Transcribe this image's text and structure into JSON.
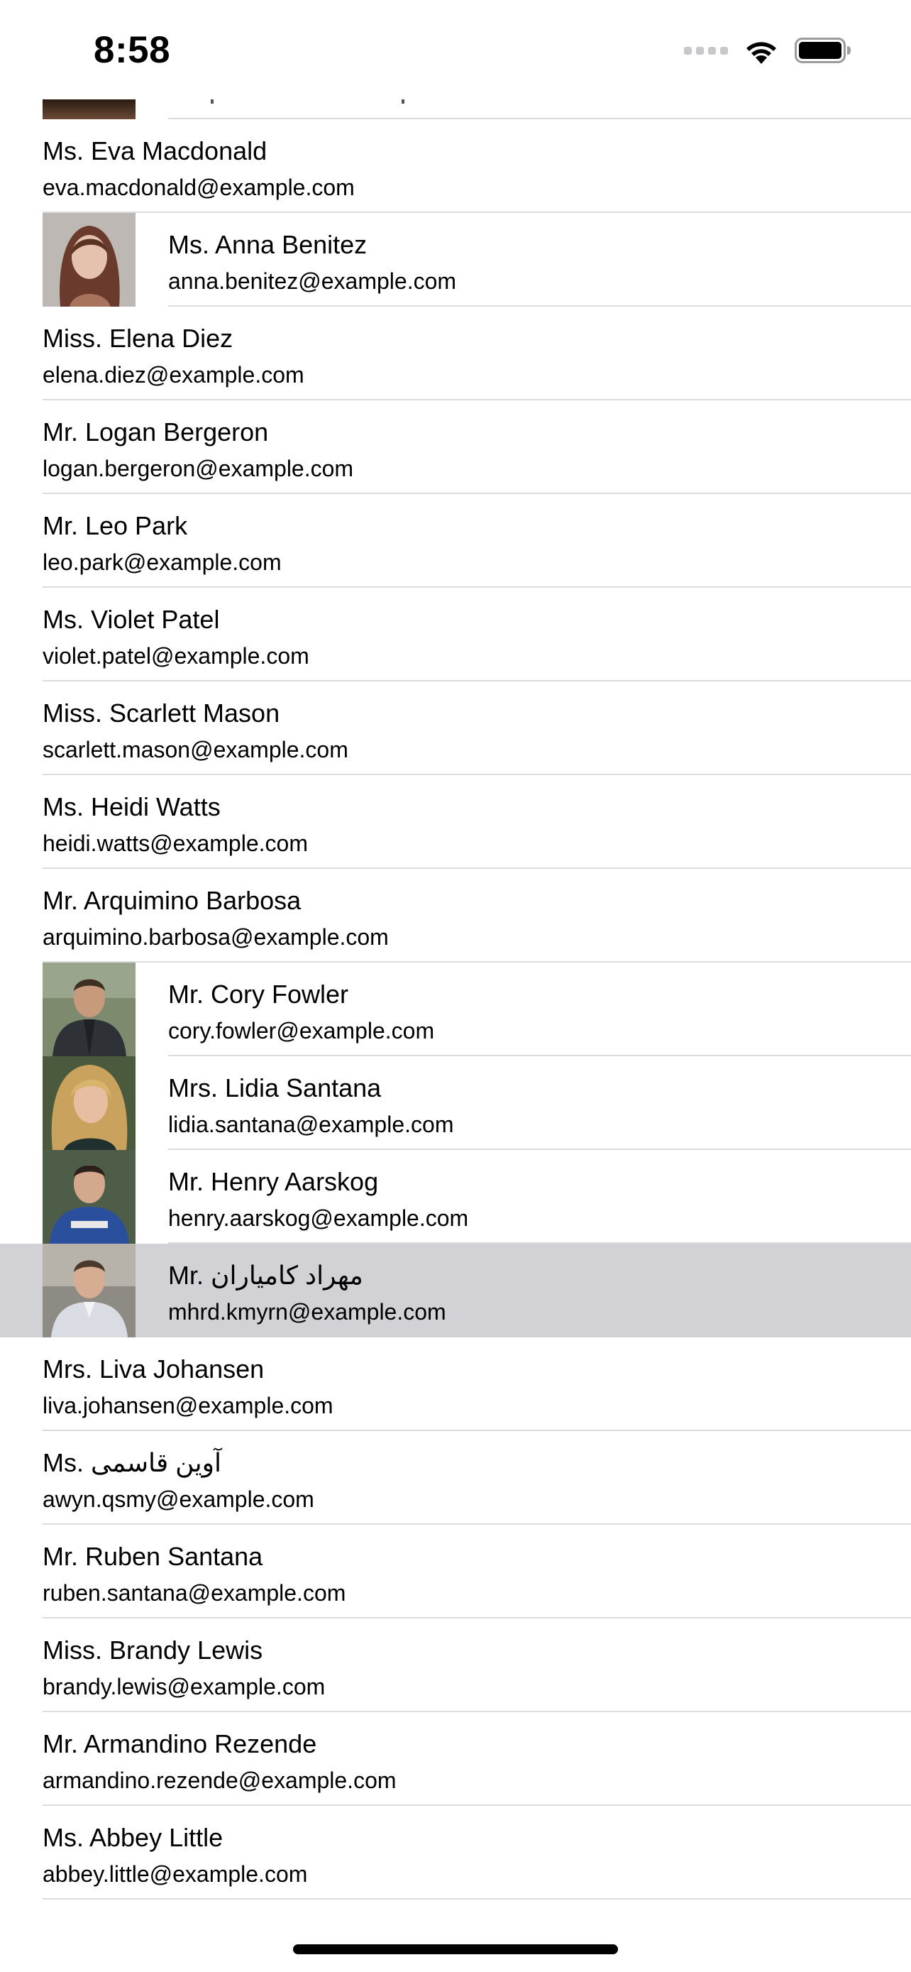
{
  "status_bar": {
    "time": "8:58"
  },
  "contacts": [
    {
      "name": "Ms. Eva Macdonald",
      "email": "eva.macdonald@example.com"
    },
    {
      "name": "Ms. Anna Benitez",
      "email": "anna.benitez@example.com"
    },
    {
      "name": "Miss. Elena Diez",
      "email": "elena.diez@example.com"
    },
    {
      "name": "Mr. Logan Bergeron",
      "email": "logan.bergeron@example.com"
    },
    {
      "name": "Mr. Leo Park",
      "email": "leo.park@example.com"
    },
    {
      "name": "Ms. Violet Patel",
      "email": "violet.patel@example.com"
    },
    {
      "name": "Miss. Scarlett Mason",
      "email": "scarlett.mason@example.com"
    },
    {
      "name": "Ms. Heidi Watts",
      "email": "heidi.watts@example.com"
    },
    {
      "name": "Mr. Arquimino Barbosa",
      "email": "arquimino.barbosa@example.com"
    },
    {
      "name": "Mr. Cory Fowler",
      "email": "cory.fowler@example.com"
    },
    {
      "name": "Mrs. Lidia Santana",
      "email": "lidia.santana@example.com"
    },
    {
      "name": "Mr. Henry Aarskog",
      "email": "henry.aarskog@example.com"
    },
    {
      "name": "Mr. مهراد کامیاران",
      "email": "mhrd.kmyrn@example.com"
    },
    {
      "name": "Mrs. Liva Johansen",
      "email": "liva.johansen@example.com"
    },
    {
      "name": "Ms. آوین قاسمی",
      "email": "awyn.qsmy@example.com"
    },
    {
      "name": "Mr. Ruben Santana",
      "email": "ruben.santana@example.com"
    },
    {
      "name": "Miss. Brandy Lewis",
      "email": "brandy.lewis@example.com"
    },
    {
      "name": "Mr. Armandino Rezende",
      "email": "armandino.rezende@example.com"
    },
    {
      "name": "Ms. Abbey Little",
      "email": "abbey.little@example.com"
    }
  ]
}
